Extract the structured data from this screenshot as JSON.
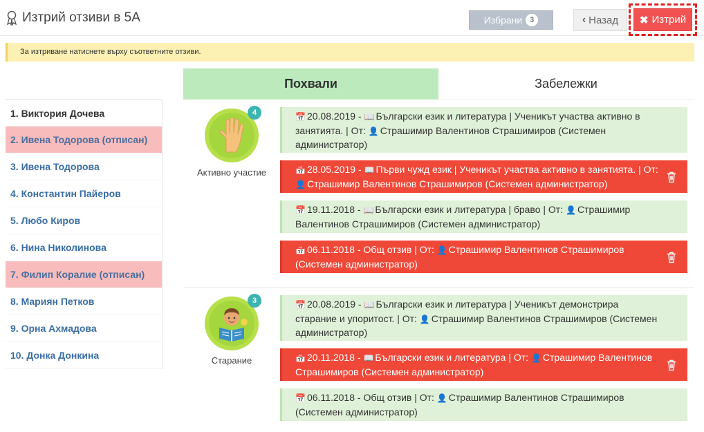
{
  "header": {
    "title": "Изтрий отзиви в 5А",
    "selected_label": "Избрани",
    "selected_count": "3",
    "back_label": "Назад",
    "delete_label": "Изтрий"
  },
  "info": "За изтриване натиснете върху съответните отзиви.",
  "tabs": [
    "Похвали",
    "Забележки"
  ],
  "students": [
    "1. Виктория Дочева",
    "2. Ивена Тодорова (отписан)",
    "3. Ивена Тодорова",
    "4. Константин Пайеров",
    "5. Любо Киров",
    "6. Нина Николинова",
    "7. Филип Коралие (отписан)",
    "8. Мариян Петков",
    "9. Орна Ахмадова",
    "10. Донка Донкина"
  ],
  "categories": [
    {
      "name": "Активно участие",
      "count": "4",
      "items": [
        {
          "date": "20.08.2019",
          "text": "Български език и литература | Ученикът участва активно в занятията. | От:",
          "author": "Страшимир Валентинов Страшимиров (Системен администратор)",
          "selected": false
        },
        {
          "date": "28.05.2019",
          "text": "Първи чужд език | Ученикът участва активно в занятията. | От:",
          "author": "Страшимир Валентинов Страшимиров (Системен администратор)",
          "selected": true
        },
        {
          "date": "19.11.2018",
          "text": "Български език и литература | браво | От:",
          "author": "Страшимир Валентинов Страшимиров (Системен администратор)",
          "selected": false
        },
        {
          "date": "06.11.2018",
          "text": "Общ отзив | От:",
          "author": "Страшимир Валентинов Страшимиров (Системен администратор)",
          "selected": true
        }
      ]
    },
    {
      "name": "Старание",
      "count": "3",
      "items": [
        {
          "date": "20.08.2019",
          "text": "Български език и литература | Ученикът демонстрира старание и упоритост. | От:",
          "author": "Страшимир Валентинов Страшимиров (Системен администратор)",
          "selected": false
        },
        {
          "date": "20.11.2018",
          "text": "Български език и литература | От:",
          "author": "Страшимир Валентинов Страшимиров (Системен администратор)",
          "selected": true
        },
        {
          "date": "06.11.2018",
          "text": "Общ отзив | От:",
          "author": "Страшимир Валентинов Страшимиров (Системен администратор)",
          "selected": false
        }
      ]
    }
  ],
  "colors": {
    "selected_bg": "#f04838",
    "unselected_bg": "#dff1d8",
    "active_tab": "#bdeabd",
    "category_circle": "#b6e04a",
    "count_badge": "#3cb5b0",
    "withdrawn_bg": "#f8bcbc"
  }
}
